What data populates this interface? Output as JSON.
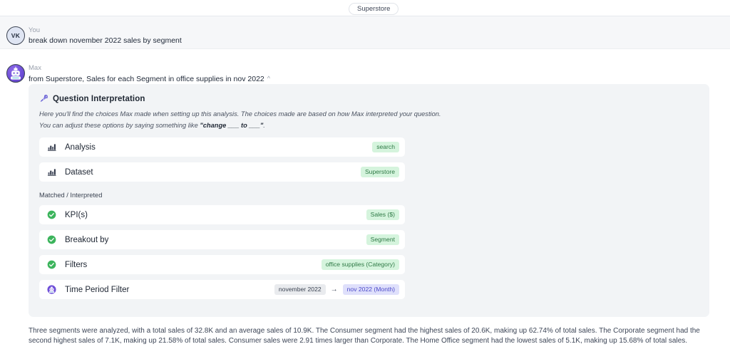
{
  "topbar": {
    "tab_label": "Superstore"
  },
  "messages": [
    {
      "sender": "You",
      "avatar_initials": "VK",
      "avatar_icon": "user-initials-avatar",
      "text": "break down november 2022 sales by segment"
    },
    {
      "sender": "Max",
      "avatar_icon": "max-robot-avatar",
      "text": "from Superstore, Sales for each Segment in office supplies in nov 2022",
      "collapse_icon": "chevron-up-icon"
    }
  ],
  "question_interpretation": {
    "icon": "interpretation-icon",
    "title": "Question Interpretation",
    "description_line1": "Here you'll find the choices Max made when setting up this analysis. The choices made are based on how Max interpreted your question.",
    "description_line2_prefix": "You can adjust these options by saying something like ",
    "description_line2_bold": "\"change ___ to ___\"",
    "description_line2_suffix": ".",
    "section_label": "Matched / Interpreted",
    "top_rows": [
      {
        "icon": "bar-chart-icon",
        "label": "Analysis",
        "badge": "search",
        "badge_style": "green"
      },
      {
        "icon": "bar-chart-icon",
        "label": "Dataset",
        "badge": "Superstore",
        "badge_style": "green"
      }
    ],
    "matched_rows": [
      {
        "icon": "check-circle-icon",
        "label": "KPI(s)",
        "badge": "Sales ($)",
        "badge_style": "green"
      },
      {
        "icon": "check-circle-icon",
        "label": "Breakout by",
        "badge": "Segment",
        "badge_style": "green"
      },
      {
        "icon": "check-circle-icon",
        "label": "Filters",
        "badge": "office supplies (Category)",
        "badge_style": "green"
      }
    ],
    "time_period_row": {
      "icon": "max-robot-icon",
      "label": "Time Period Filter",
      "from_badge": "november 2022",
      "arrow": "→",
      "to_badge": "nov 2022 (Month)"
    }
  },
  "summary": {
    "text": "Three segments were analyzed, with a total sales of 32.8K and an average sales of 10.9K. The Consumer segment had the highest sales of 20.6K, making up 62.74% of total sales. The Corporate segment had the second highest sales of 7.1K, making up 21.58% of total sales. Consumer sales were 2.91 times larger than Corporate. The Home Office segment had the lowest sales of 5.1K, making up 15.68% of total sales."
  },
  "colors": {
    "panel_bg": "#f2f4f6",
    "badge_green_bg": "#d5f4dd",
    "badge_green_text": "#2f7a46",
    "badge_blue_bg": "#dfe0fb",
    "badge_blue_text": "#4b49c9",
    "badge_gray_bg": "#e9ebee",
    "accent_purple": "#6f4fd8",
    "check_green": "#3cb45c"
  }
}
